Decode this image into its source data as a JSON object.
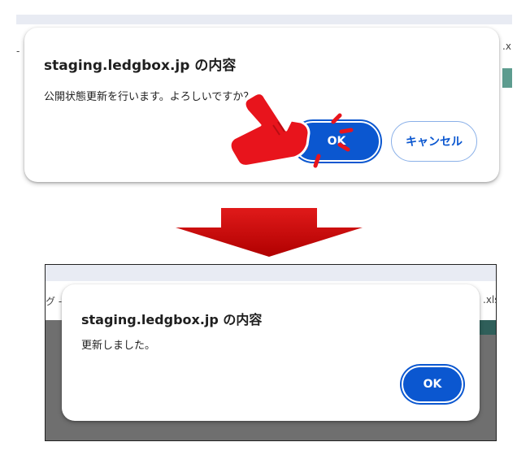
{
  "top": {
    "bg_left_fragment": "-",
    "bg_right_fragment": ".x",
    "dialog_title": "staging.ledgbox.jp の内容",
    "dialog_message": "公開状態更新を行います。よろしいですか？",
    "ok_label": "OK",
    "cancel_label": "キャンセル"
  },
  "arrow": {
    "color": "#d40000",
    "direction": "down"
  },
  "bottom": {
    "bg_left_fragment": "グ -",
    "bg_right_fragment": ".xls",
    "dialog_title": "staging.ledgbox.jp の内容",
    "dialog_message": "更新しました。",
    "ok_label": "OK"
  },
  "colors": {
    "accent": "#0b57d0",
    "pointer": "#e8141c"
  },
  "icons": [
    "hand-pointer-icon",
    "click-burst-icon",
    "down-arrow-icon"
  ]
}
